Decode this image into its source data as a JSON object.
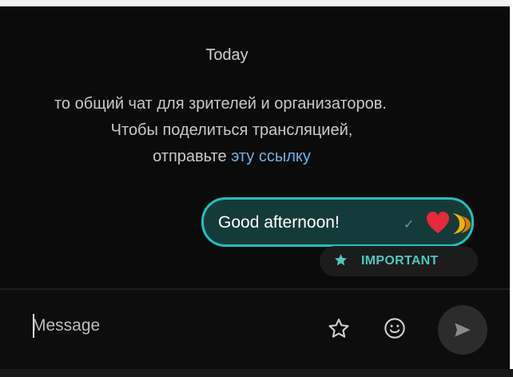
{
  "chat": {
    "date_label": "Today",
    "system_message": {
      "line1": "то общий чат для зрителей и организаторов.",
      "line2": "Чтобы поделиться трансляцией,",
      "line3_prefix": "отправьте ",
      "line3_link": "эту ссылку"
    }
  },
  "message": {
    "text": "Good afternoon!",
    "status_icon": "check-icon",
    "reaction_icons": [
      "heart-icon",
      "moon-icon"
    ],
    "tag_label": "IMPORTANT",
    "tag_icon": "star-icon"
  },
  "composer": {
    "placeholder": "Message",
    "favorite_icon": "star-outline-icon",
    "emoji_icon": "smiley-icon",
    "send_icon": "send-arrow-icon"
  },
  "colors": {
    "accent": "#1bc4bb",
    "bubble_fill": "#143a39",
    "background": "#0b0b0b",
    "link": "#6fb3e8",
    "heart": "#e8283c",
    "moon": "#f2b200"
  }
}
